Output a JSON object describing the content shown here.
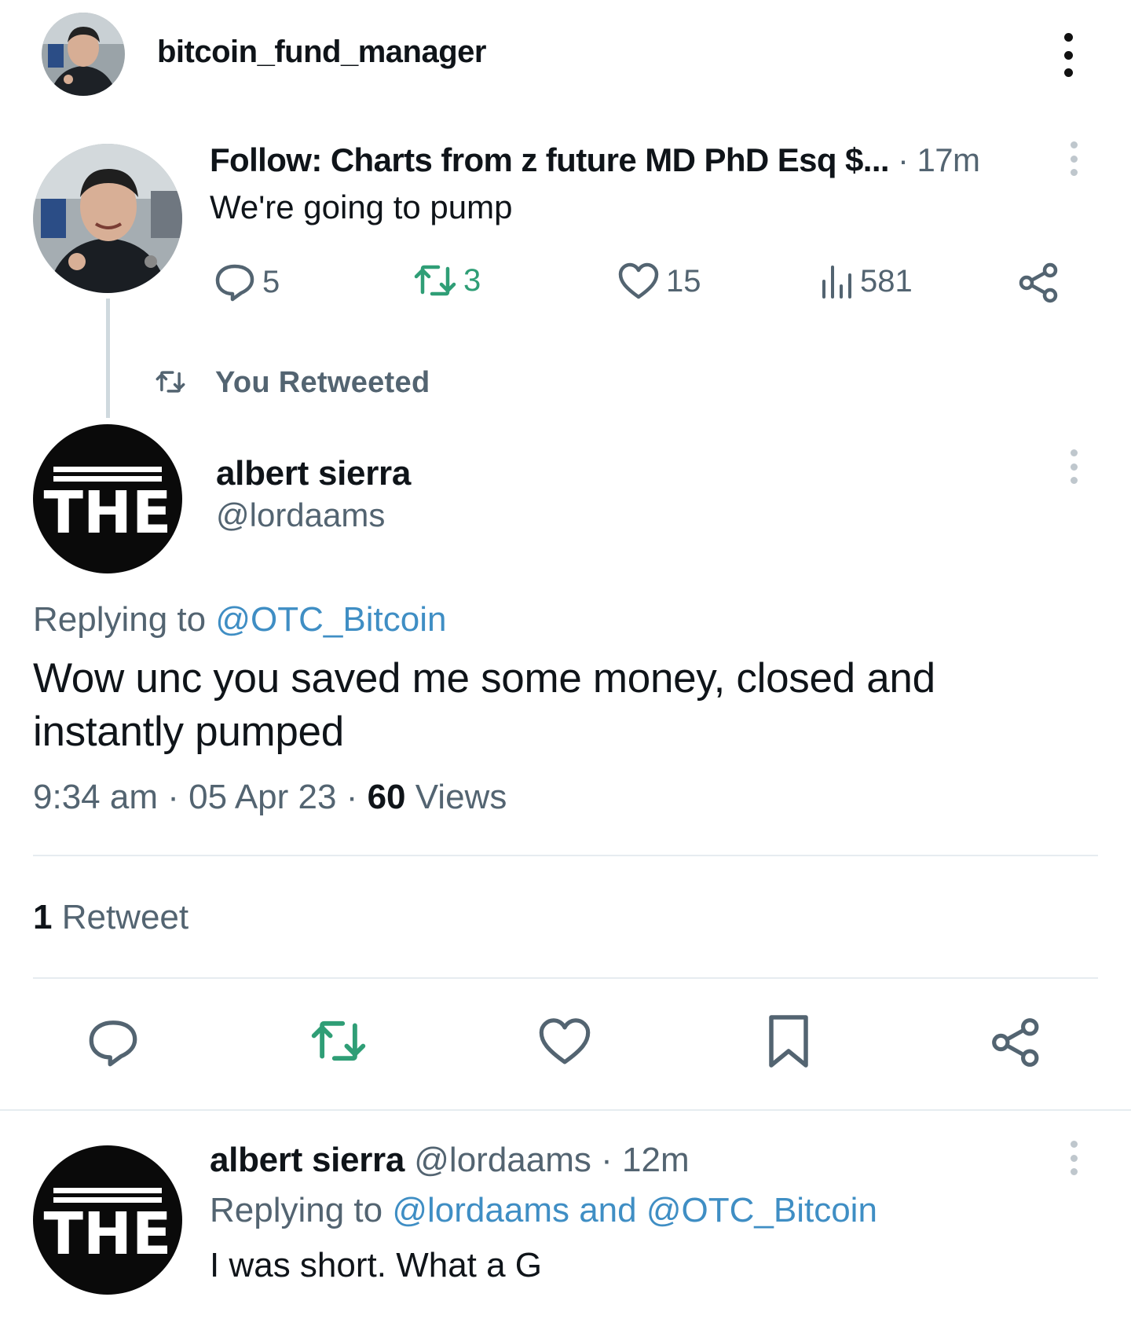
{
  "header": {
    "username": "bitcoin_fund_manager",
    "more_icon": "vertical-ellipsis-icon"
  },
  "parent_tweet": {
    "author": "Follow: Charts from z future MD PhD Esq $...",
    "separator": " · ",
    "time": "17m",
    "text": "We're going to pump",
    "replies": "5",
    "retweets": "3",
    "likes": "15",
    "views": "581"
  },
  "retweet_context": {
    "label": "You Retweeted"
  },
  "main_tweet": {
    "author_name": "albert sierra",
    "handle": "@lordaams",
    "avatar_text": "THE",
    "replying_prefix": "Replying to ",
    "replying_to": "@OTC_Bitcoin",
    "text": "Wow unc you saved me some money, closed and instantly pumped",
    "time": "9:34 am",
    "date": "05 Apr 23",
    "dot": " · ",
    "views_count": "60",
    "views_label": " Views",
    "retweet_count": "1",
    "retweet_label": " Retweet"
  },
  "reply_tweet": {
    "author_name": "albert sierra",
    "handle": " @lordaams",
    "separator": " · ",
    "time": "12m",
    "replying_prefix": "Replying to ",
    "replying_to": "@lordaams and @OTC_Bitcoin",
    "text": "I was short. What a G"
  },
  "colors": {
    "link": "#3f8ec4",
    "retweet_green": "#2f9e76",
    "muted": "#536471",
    "text": "#0f1419"
  }
}
